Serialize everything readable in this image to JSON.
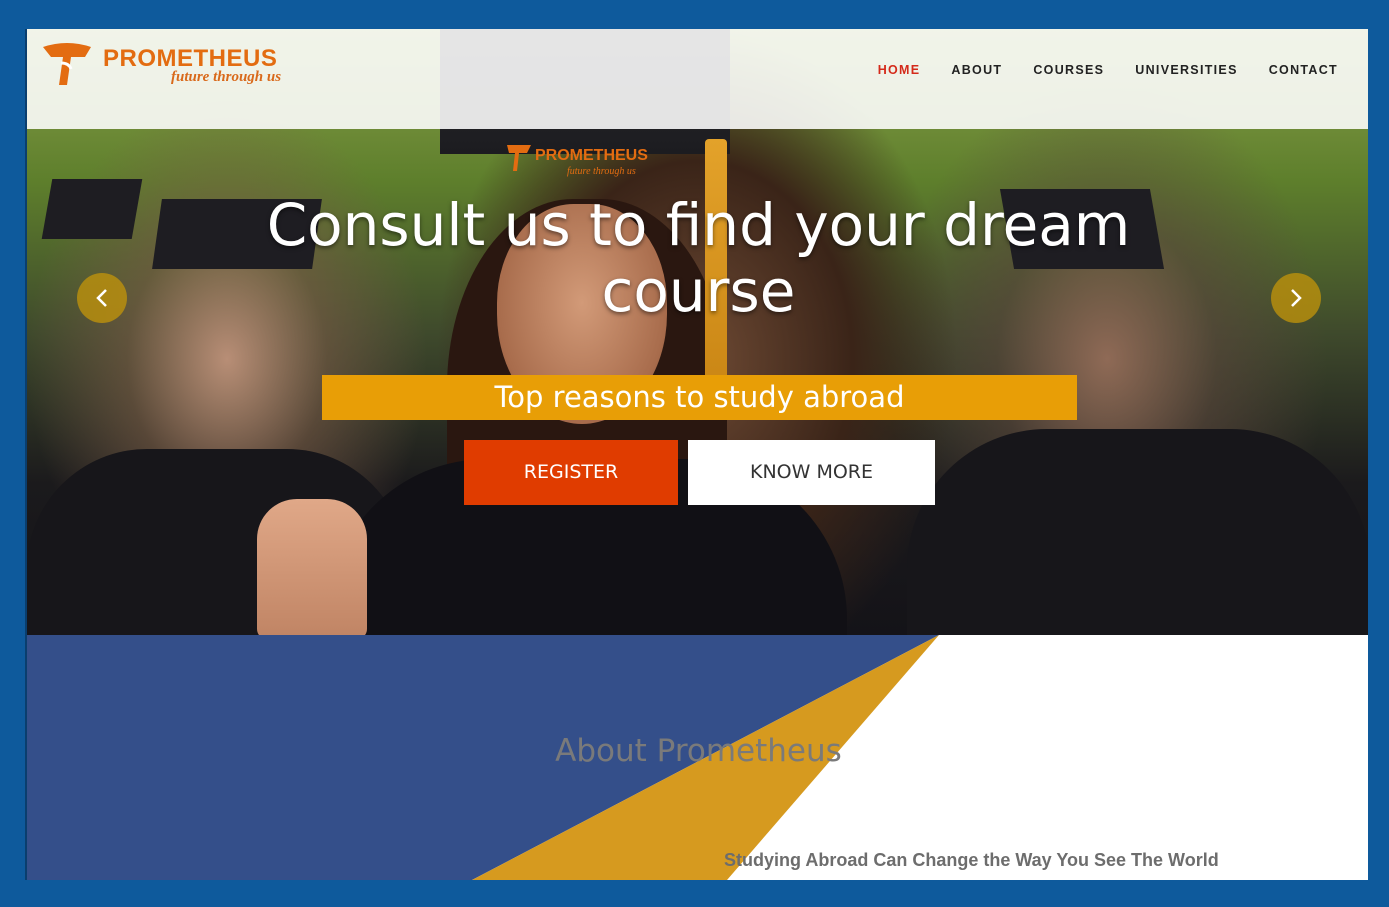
{
  "brand": {
    "name": "PROMETHEUS",
    "tagline": "future through us",
    "cap_name": "PROMETHEUS",
    "cap_tagline": "future through us"
  },
  "nav": {
    "items": [
      {
        "label": "HOME",
        "active": true
      },
      {
        "label": "ABOUT",
        "active": false
      },
      {
        "label": "COURSES",
        "active": false
      },
      {
        "label": "UNIVERSITIES",
        "active": false
      },
      {
        "label": "CONTACT",
        "active": false
      }
    ]
  },
  "hero": {
    "title_line1": "Consult us to find your dream",
    "title_line2": "course",
    "subtitle": "Top reasons to study abroad",
    "register_label": "REGISTER",
    "know_more_label": "KNOW MORE",
    "prev_icon": "chevron-left-icon",
    "next_icon": "chevron-right-icon"
  },
  "about": {
    "title": "About Prometheus",
    "subtitle": "Studying Abroad Can Change the Way You See The World"
  },
  "colors": {
    "frame": "#0e5a9c",
    "accent": "#e89e06",
    "register": "#e03c00",
    "nav_active": "#d42a1a",
    "about_blue": "#344f8a",
    "about_gold": "#d69a1f"
  }
}
